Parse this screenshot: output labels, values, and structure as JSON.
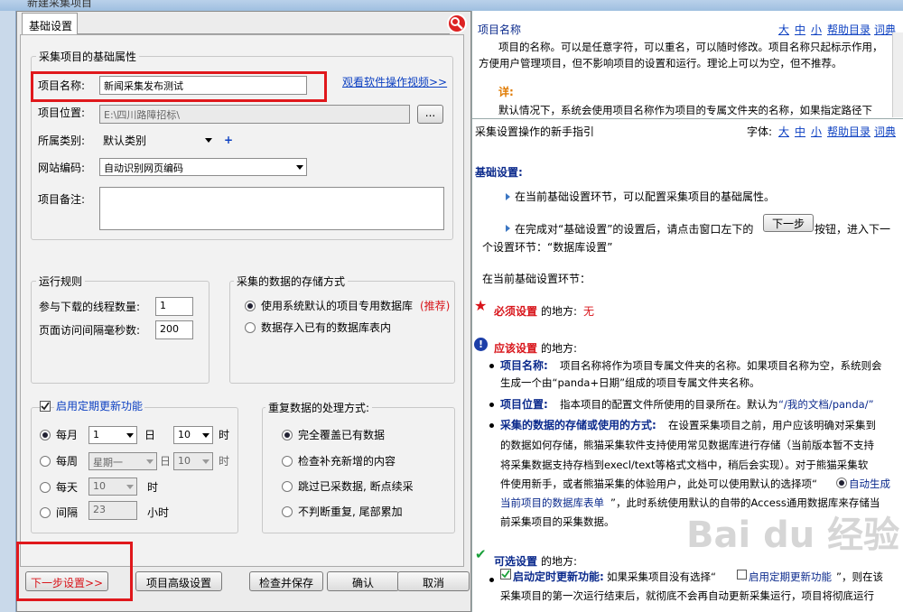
{
  "window": {
    "title": "新建采集项目"
  },
  "tab": {
    "label": "基础设置"
  },
  "basic": {
    "group_title": "采集项目的基础属性",
    "name_label": "项目名称:",
    "name_value": "新闻采集发布测试",
    "video_link": "观看软件操作视频>>",
    "location_label": "项目位置:",
    "location_value": "E:\\四川路障招标\\",
    "browse_label": "...",
    "category_label": "所属类别:",
    "category_value": "默认类别",
    "add_label": "+",
    "encoding_label": "网站编码:",
    "encoding_value": "自动识别网页编码",
    "note_label": "项目备注:"
  },
  "run": {
    "title": "运行规则",
    "threads_label": "参与下载的线程数量:",
    "threads_value": "1",
    "interval_label": "页面访问间隔毫秒数:",
    "interval_value": "200"
  },
  "storage": {
    "title": "采集的数据的存储方式",
    "option1": "使用系统默认的项目专用数据库",
    "recommend": "(推荐)",
    "option2": "数据存入已有的数据库表内"
  },
  "schedule": {
    "enable_label": "启用定期更新功能",
    "monthly": "每月",
    "monthly_value": "1",
    "day": "日",
    "hour_value": "10",
    "hour": "时",
    "weekly": "每周",
    "weekday_value": "星期一",
    "daily": "每天",
    "daily_value": "10",
    "interval": "间隔",
    "interval_value": "23",
    "hours": "小时"
  },
  "dedupe": {
    "title": "重复数据的处理方式:",
    "opt1": "完全覆盖已有数据",
    "opt2": "检查补充新增的内容",
    "opt3": "跳过已采数据, 断点续采",
    "opt4": "不判断重复, 尾部累加"
  },
  "buttons": {
    "next": "下一步设置>>",
    "advanced": "项目高级设置",
    "check_save": "检查并保存",
    "ok": "确认",
    "cancel": "取消"
  },
  "help": {
    "top_title": "项目名称",
    "size_large": "大",
    "size_mid": "中",
    "size_small": "小",
    "help_dir": "帮助目录",
    "dict": "词典",
    "top_text": "项目的名称。可以是任意字符，可以重名，可以随时修改。项目名称只起标示作用，方便用户管理项目，但不影响项目的设置和运行。理论上可以为空，但不推荐。",
    "detail": "详:",
    "top_text2": "默认情况下，系统会使用项目名称作为项目的专属文件夹的名称，如果指定路径下",
    "guide_title": "采集设置操作的新手指引",
    "font_label": "字体:",
    "section_title": "基础设置:",
    "tip1": "在当前基础设置环节，可以配置采集项目的基础属性。",
    "tip2a": "在完成对“基础设置”的设置后，请点击窗口左下的",
    "next_btn": "下一步",
    "tip2b": "按钮，进入下一",
    "tip2c": "个设置环节：“数据库设置”",
    "current_env": "在当前基础设置环节：",
    "must_prefix": "必须设置",
    "must_suffix": "的地方:",
    "must_value": "无",
    "should_prefix": "应该设置",
    "should_suffix": "的地方:",
    "b1_title": "项目名称:",
    "b1_text": "项目名称将作为项目专属文件夹的名称。如果项目名称为空，系统则会",
    "b1_text2": "生成一个由“panda+日期”组成的项目专属文件夹名称。",
    "b2_title": "项目位置:",
    "b2_text": "指本项目的配置文件所使用的目录所在。默认为",
    "b2_path": "“/我的文档/panda/”",
    "b3_title": "采集的数据的存储或使用的方式:",
    "b3_text": "在设置采集项目之前，用户应该明确对采集到",
    "b3_l2": "的数据如何存储，熊猫采集软件支持使用常见数据库进行存储（当前版本暂不支持",
    "b3_l3": "将采集数据支持存档到execl/text等格式文档中，稍后会实现）。对于熊猫采集软",
    "b3_l4a": "件使用新手，或者熊猫采集的体验用户，此处可以使用默认的选择项“",
    "b3_l4b": "自动生成",
    "b3_l5a": "当前项目的数据库表单",
    "b3_l5b": "”，此时系统使用默认的自带的Access通用数据库来存储当",
    "b3_l6": "前采集项目的采集数据。",
    "opt_prefix": "可选设置",
    "opt_suffix": "的地方:",
    "c1_title": "启动定时更新功能:",
    "c1_text": "如果采集项目没有选择“",
    "c1_link": "启用定期更新功能",
    "c1_text2": "”，则在该",
    "c1_l2": "采集项目的第一次运行结束后，就彻底不会再自动更新采集运行，项目将彻底运行"
  },
  "watermark": "Bai du 经验"
}
